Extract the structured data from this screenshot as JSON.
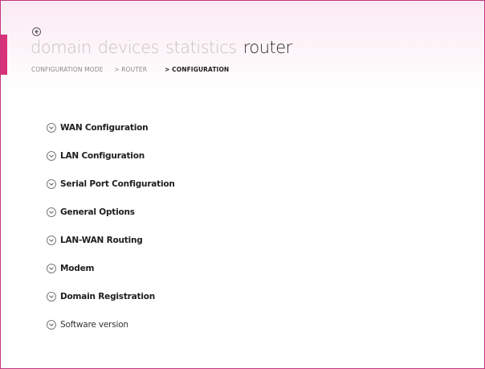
{
  "header": {
    "back_icon": "back-arrow-icon",
    "tabs": [
      {
        "label": "domain",
        "active": false
      },
      {
        "label": "devices",
        "active": false
      },
      {
        "label": "statistics",
        "active": false
      },
      {
        "label": "router",
        "active": true
      }
    ],
    "breadcrumb": [
      "CONFIGURATION MODE",
      "> ROUTER",
      "> CONFIGURATION"
    ]
  },
  "sections": [
    {
      "label": "WAN Configuration",
      "icon": "chevron-down-circle-icon"
    },
    {
      "label": "LAN Configuration",
      "icon": "chevron-down-circle-icon"
    },
    {
      "label": "Serial Port Configuration",
      "icon": "chevron-down-circle-icon"
    },
    {
      "label": "General Options",
      "icon": "chevron-down-circle-icon"
    },
    {
      "label": "LAN-WAN Routing",
      "icon": "chevron-down-circle-icon"
    },
    {
      "label": "Modem",
      "icon": "chevron-down-circle-icon"
    },
    {
      "label": "Domain Registration",
      "icon": "chevron-down-circle-icon"
    },
    {
      "label": "Software version",
      "icon": "chevron-down-circle-icon"
    }
  ],
  "colors": {
    "accent": "#d8327a",
    "border": "#c2377e",
    "tab_inactive": "#c4c4c4",
    "tab_active": "#2e2e2e"
  }
}
